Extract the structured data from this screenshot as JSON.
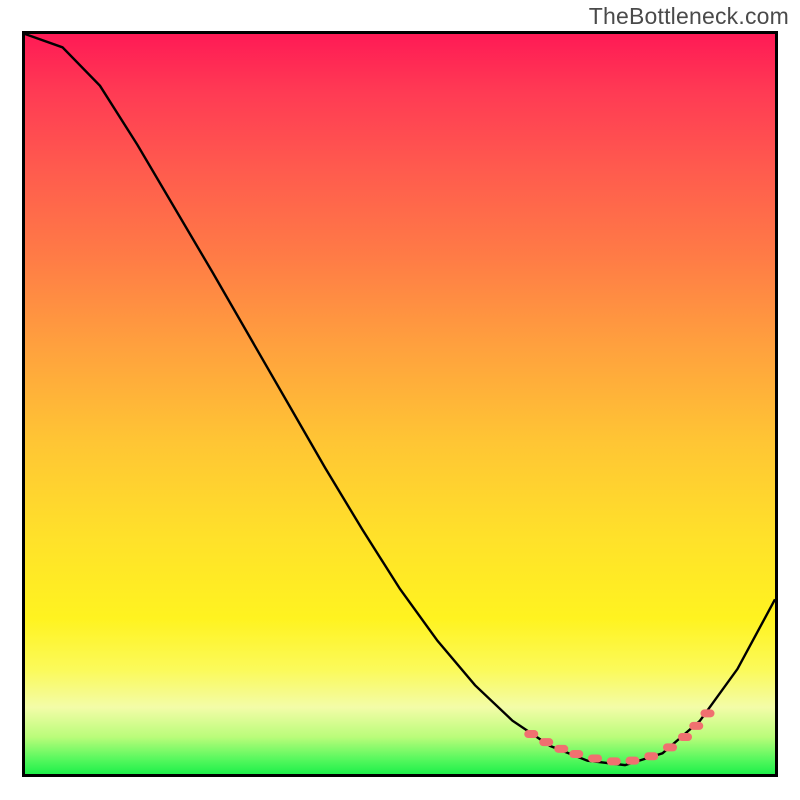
{
  "watermark": "TheBottleneck.com",
  "colors": {
    "frame_border": "#000000",
    "curve_stroke": "#000000",
    "bead_fill": "#f07070",
    "gradient_top": "#ff1a55",
    "gradient_bottom": "#1ef04a"
  },
  "chart_data": {
    "type": "line",
    "title": "",
    "xlabel": "",
    "ylabel": "",
    "xlim": [
      0,
      100
    ],
    "ylim": [
      0,
      100
    ],
    "note": "Axes are unlabeled; values are fractional positions estimated from pixel geometry (0=left/bottom, 100=right/top). Curve is a steep descent that bottoms near x≈78–83 then rises.",
    "series": [
      {
        "name": "curve",
        "x": [
          0.0,
          5.0,
          10.0,
          15.0,
          20.0,
          25.0,
          30.0,
          35.0,
          40.0,
          45.0,
          50.0,
          55.0,
          60.0,
          65.0,
          70.0,
          75.0,
          80.0,
          85.0,
          90.0,
          95.0,
          100.0
        ],
        "y": [
          100.0,
          98.2,
          93.0,
          85.0,
          76.4,
          67.8,
          59.0,
          50.2,
          41.4,
          33.0,
          25.0,
          18.0,
          12.0,
          7.2,
          3.8,
          1.8,
          1.2,
          2.8,
          7.2,
          14.2,
          23.6
        ]
      }
    ],
    "markers": {
      "name": "beads",
      "description": "Pink-red rounded beads clustered along the trough of the curve.",
      "x": [
        67.5,
        69.5,
        71.5,
        73.5,
        76.0,
        78.5,
        81.0,
        83.5,
        86.0,
        88.0,
        89.5,
        91.0
      ],
      "y": [
        5.4,
        4.3,
        3.4,
        2.7,
        2.1,
        1.7,
        1.8,
        2.4,
        3.6,
        5.0,
        6.5,
        8.2
      ]
    }
  }
}
